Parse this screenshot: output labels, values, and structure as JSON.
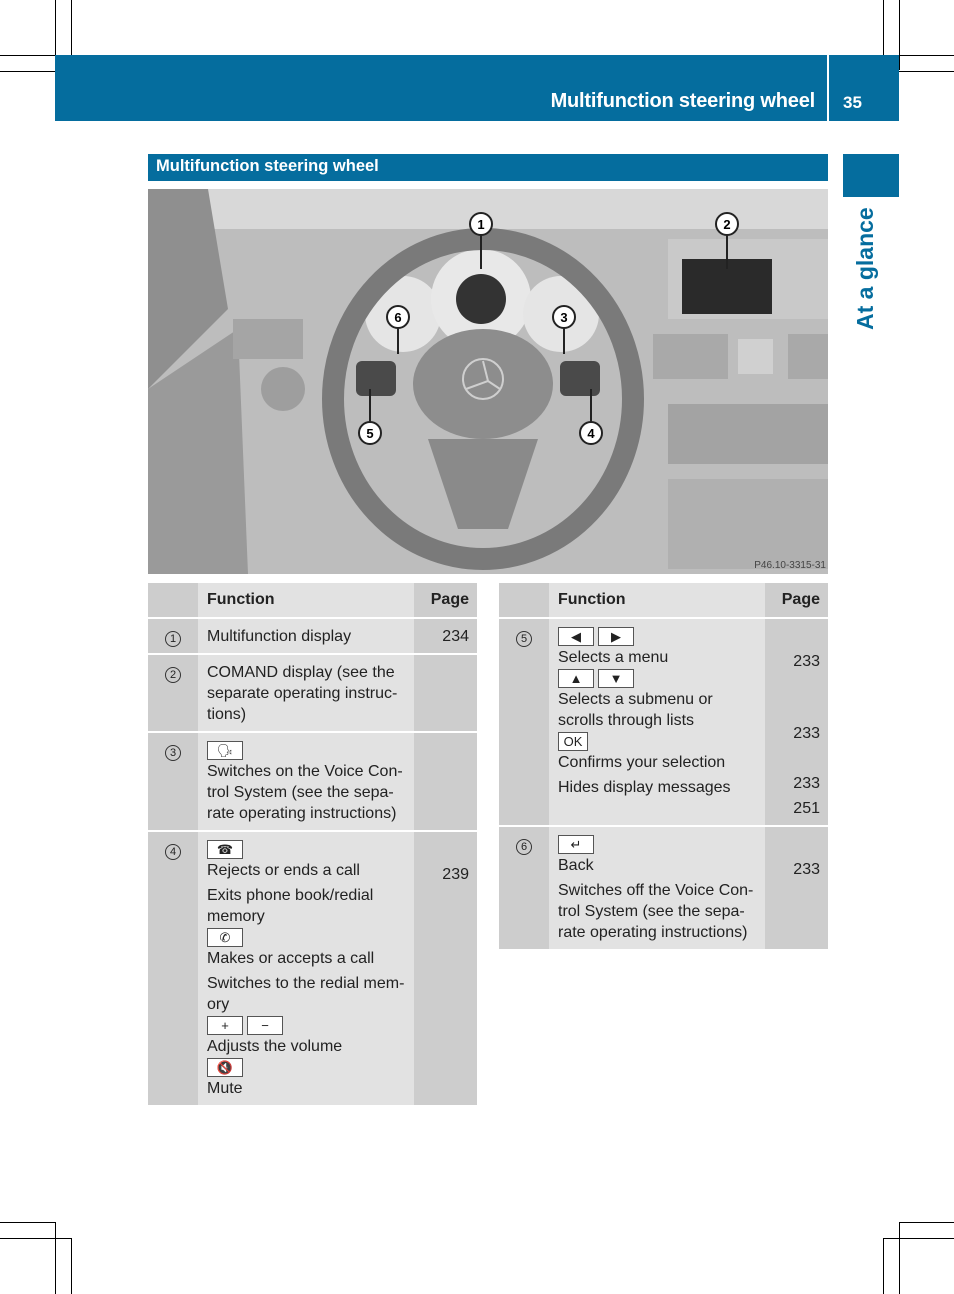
{
  "header": {
    "title": "Multifunction steering wheel",
    "page_number": "35"
  },
  "section": {
    "title": "Multifunction steering wheel",
    "side_tab_label": "At a glance"
  },
  "photo": {
    "callouts": [
      "1",
      "2",
      "3",
      "4",
      "5",
      "6"
    ],
    "reference_code": "P46.10-3315-31"
  },
  "left_table": {
    "headers": {
      "number": "",
      "function": "Function",
      "page": "Page"
    },
    "rows": [
      {
        "number": "1",
        "lines": [
          "Multifunction display"
        ],
        "page": "234"
      },
      {
        "number": "2",
        "lines": [
          "COMAND display (see the",
          "separate operating instruc-",
          "tions)"
        ],
        "page": ""
      },
      {
        "number": "3",
        "key": "voice-control-icon",
        "lines": [
          "Switches on the Voice Con-",
          "trol System (see the sepa-",
          "rate operating instructions)"
        ],
        "page": ""
      },
      {
        "number": "4",
        "blocks": [
          {
            "keys": [
              "end-call-icon"
            ],
            "lines": [
              "Rejects or ends a call"
            ],
            "page": "239"
          },
          {
            "lines": [
              "Exits phone book/redial",
              "memory"
            ]
          },
          {
            "keys": [
              "accept-call-icon"
            ],
            "lines": [
              "Makes or accepts a call"
            ]
          },
          {
            "lines": [
              "Switches to the redial mem-",
              "ory"
            ]
          },
          {
            "keys": [
              "plus-icon",
              "minus-icon"
            ],
            "lines": [
              "Adjusts the volume"
            ]
          },
          {
            "keys": [
              "mute-icon"
            ],
            "lines": [
              "Mute"
            ]
          }
        ]
      }
    ]
  },
  "right_table": {
    "headers": {
      "number": "",
      "function": "Function",
      "page": "Page"
    },
    "rows": [
      {
        "number": "5",
        "blocks": [
          {
            "keys": [
              "left-arrow-icon",
              "right-arrow-icon"
            ],
            "lines": [
              "Selects a menu"
            ],
            "page": "233"
          },
          {
            "keys": [
              "up-arrow-icon",
              "down-arrow-icon"
            ],
            "lines": [
              "Selects a submenu or",
              "scrolls through lists"
            ],
            "page": "233"
          },
          {
            "keys": [
              "ok"
            ],
            "key_label": "OK",
            "lines": [
              "Confirms your selection"
            ],
            "page": "233"
          },
          {
            "lines": [
              "Hides display messages"
            ],
            "page": "251"
          }
        ]
      },
      {
        "number": "6",
        "blocks": [
          {
            "keys": [
              "back-icon"
            ],
            "lines": [
              "Back"
            ],
            "page": "233"
          },
          {
            "lines": [
              "Switches off the Voice Con-",
              "trol System (see the sepa-",
              "rate operating instructions)"
            ]
          }
        ]
      }
    ]
  }
}
